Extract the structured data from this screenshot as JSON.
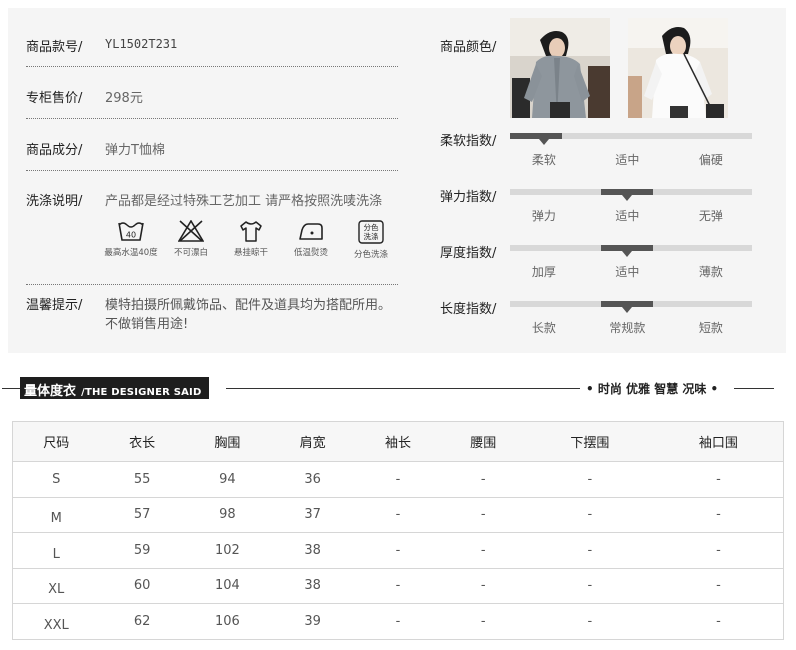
{
  "product": {
    "model_label": "商品款号/",
    "model_value": "YL1502T231",
    "price_label": "专柜售价/",
    "price_value": "298元",
    "material_label": "商品成分/",
    "material_value": "弹力T恤棉",
    "wash_label": "洗涤说明/",
    "wash_value": "产品都是经过特殊工艺加工 请严格按照洗唛洗涤",
    "wash_icons": [
      {
        "icon": "wash-40-icon",
        "caption": "最高水温40度",
        "glyph": "40"
      },
      {
        "icon": "no-bleach-icon",
        "caption": "不可漂白"
      },
      {
        "icon": "hang-dry-icon",
        "caption": "悬挂晾干"
      },
      {
        "icon": "low-iron-icon",
        "caption": "低温熨烫"
      },
      {
        "icon": "separate-wash-icon",
        "caption": "分色洗涤",
        "glyph": "分色\n洗涤"
      }
    ],
    "tips_label": "温馨提示/",
    "tips_line1": "模特拍摄所佩戴饰品、配件及道具均为搭配所用。",
    "tips_line2": "不做销售用途!"
  },
  "attributes": {
    "color_label": "商品颜色/",
    "scales": [
      {
        "label": "柔软指数/",
        "options": [
          "柔软",
          "适中",
          "偏硬"
        ],
        "selected": 0
      },
      {
        "label": "弹力指数/",
        "options": [
          "弹力",
          "适中",
          "无弹"
        ],
        "selected": 1
      },
      {
        "label": "厚度指数/",
        "options": [
          "加厚",
          "适中",
          "薄款"
        ],
        "selected": 1
      },
      {
        "label": "长度指数/",
        "options": [
          "长款",
          "常规款",
          "短款"
        ],
        "selected": 1
      }
    ]
  },
  "section": {
    "title_zh": "量体度衣",
    "title_en": "/THE DESIGNER SAID",
    "tagline": "• 时尚 优雅 智慧 况味 •"
  },
  "size_table": {
    "headers": [
      "尺码",
      "衣长",
      "胸围",
      "肩宽",
      "袖长",
      "腰围",
      "下摆围",
      "袖口围"
    ],
    "rows": [
      [
        "S",
        "55",
        "94",
        "36",
        "-",
        "-",
        "-",
        "-"
      ],
      [
        "M",
        "57",
        "98",
        "37",
        "-",
        "-",
        "-",
        "-"
      ],
      [
        "L",
        "59",
        "102",
        "38",
        "-",
        "-",
        "-",
        "-"
      ],
      [
        "XL",
        "60",
        "104",
        "38",
        "-",
        "-",
        "-",
        "-"
      ],
      [
        "XXL",
        "62",
        "106",
        "39",
        "-",
        "-",
        "-",
        "-"
      ]
    ]
  },
  "colors": {
    "panel_bg": "#f5f5f5",
    "scale_track": "#d8d8d8",
    "scale_active": "#555555",
    "header_bar": "#1e1e1e"
  }
}
